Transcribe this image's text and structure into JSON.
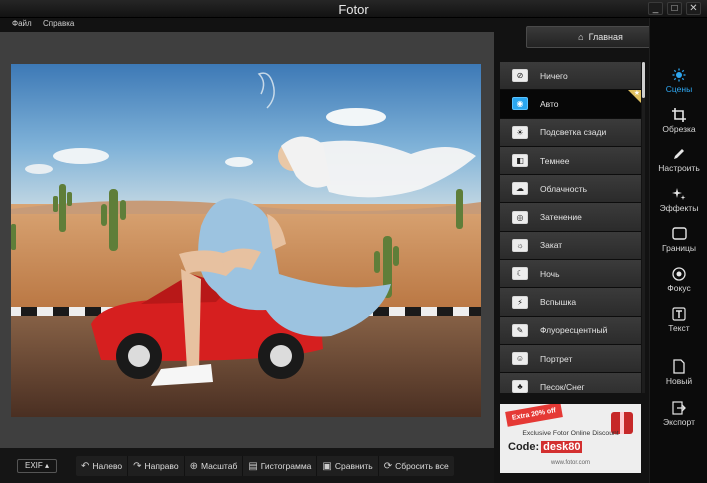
{
  "window": {
    "title": "Fotor",
    "controls": [
      "_",
      "□",
      "✕"
    ]
  },
  "menu": {
    "items": [
      "Файл",
      "Справка"
    ]
  },
  "bottom_bar": {
    "exif_label": "EXIF ▴",
    "tools": [
      {
        "label": "Налево",
        "icon": "rotate-left-icon"
      },
      {
        "label": "Направо",
        "icon": "rotate-right-icon"
      },
      {
        "label": "Масштаб",
        "icon": "zoom-icon"
      },
      {
        "label": "Гистограмма",
        "icon": "histogram-icon"
      },
      {
        "label": "Сравнить",
        "icon": "compare-icon"
      },
      {
        "label": "Сбросить все",
        "icon": "reset-icon"
      }
    ]
  },
  "panel": {
    "home_label": "Главная",
    "active_index": 1,
    "scenes": [
      {
        "label": "Ничего",
        "icon": "none-icon"
      },
      {
        "label": "Авто",
        "icon": "camera-icon",
        "favorite": true
      },
      {
        "label": "Подсветка сзади",
        "icon": "backlight-icon"
      },
      {
        "label": "Темнее",
        "icon": "darker-icon"
      },
      {
        "label": "Облачность",
        "icon": "cloud-icon"
      },
      {
        "label": "Затенение",
        "icon": "shade-icon"
      },
      {
        "label": "Закат",
        "icon": "sunset-icon"
      },
      {
        "label": "Ночь",
        "icon": "night-icon"
      },
      {
        "label": "Вспышка",
        "icon": "flash-icon"
      },
      {
        "label": "Флуоресцентный",
        "icon": "fluorescent-icon"
      },
      {
        "label": "Портрет",
        "icon": "portrait-icon"
      },
      {
        "label": "Песок/Снег",
        "icon": "beach-icon"
      }
    ],
    "ad": {
      "ribbon": "Extra 20% off",
      "text": "Exclusive Fotor Online Discount",
      "code_label": "Code:",
      "code_value": "desk80",
      "url": "www.fotor.com"
    }
  },
  "right_nav": [
    {
      "label": "Сцены",
      "icon": "scenes-icon",
      "active": true
    },
    {
      "label": "Обрезка",
      "icon": "crop-icon"
    },
    {
      "label": "Настроить",
      "icon": "pencil-icon"
    },
    {
      "label": "Эффекты",
      "icon": "effects-icon"
    },
    {
      "label": "Границы",
      "icon": "borders-icon"
    },
    {
      "label": "Фокус",
      "icon": "focus-icon"
    },
    {
      "label": "Текст",
      "icon": "text-icon"
    },
    {
      "label": "Новый",
      "icon": "new-file-icon"
    },
    {
      "label": "Экспорт",
      "icon": "export-icon"
    }
  ],
  "colors": {
    "accent": "#2aa6ef",
    "panel_bg": "#121212",
    "canvas_bg": "#3f3f3f"
  }
}
